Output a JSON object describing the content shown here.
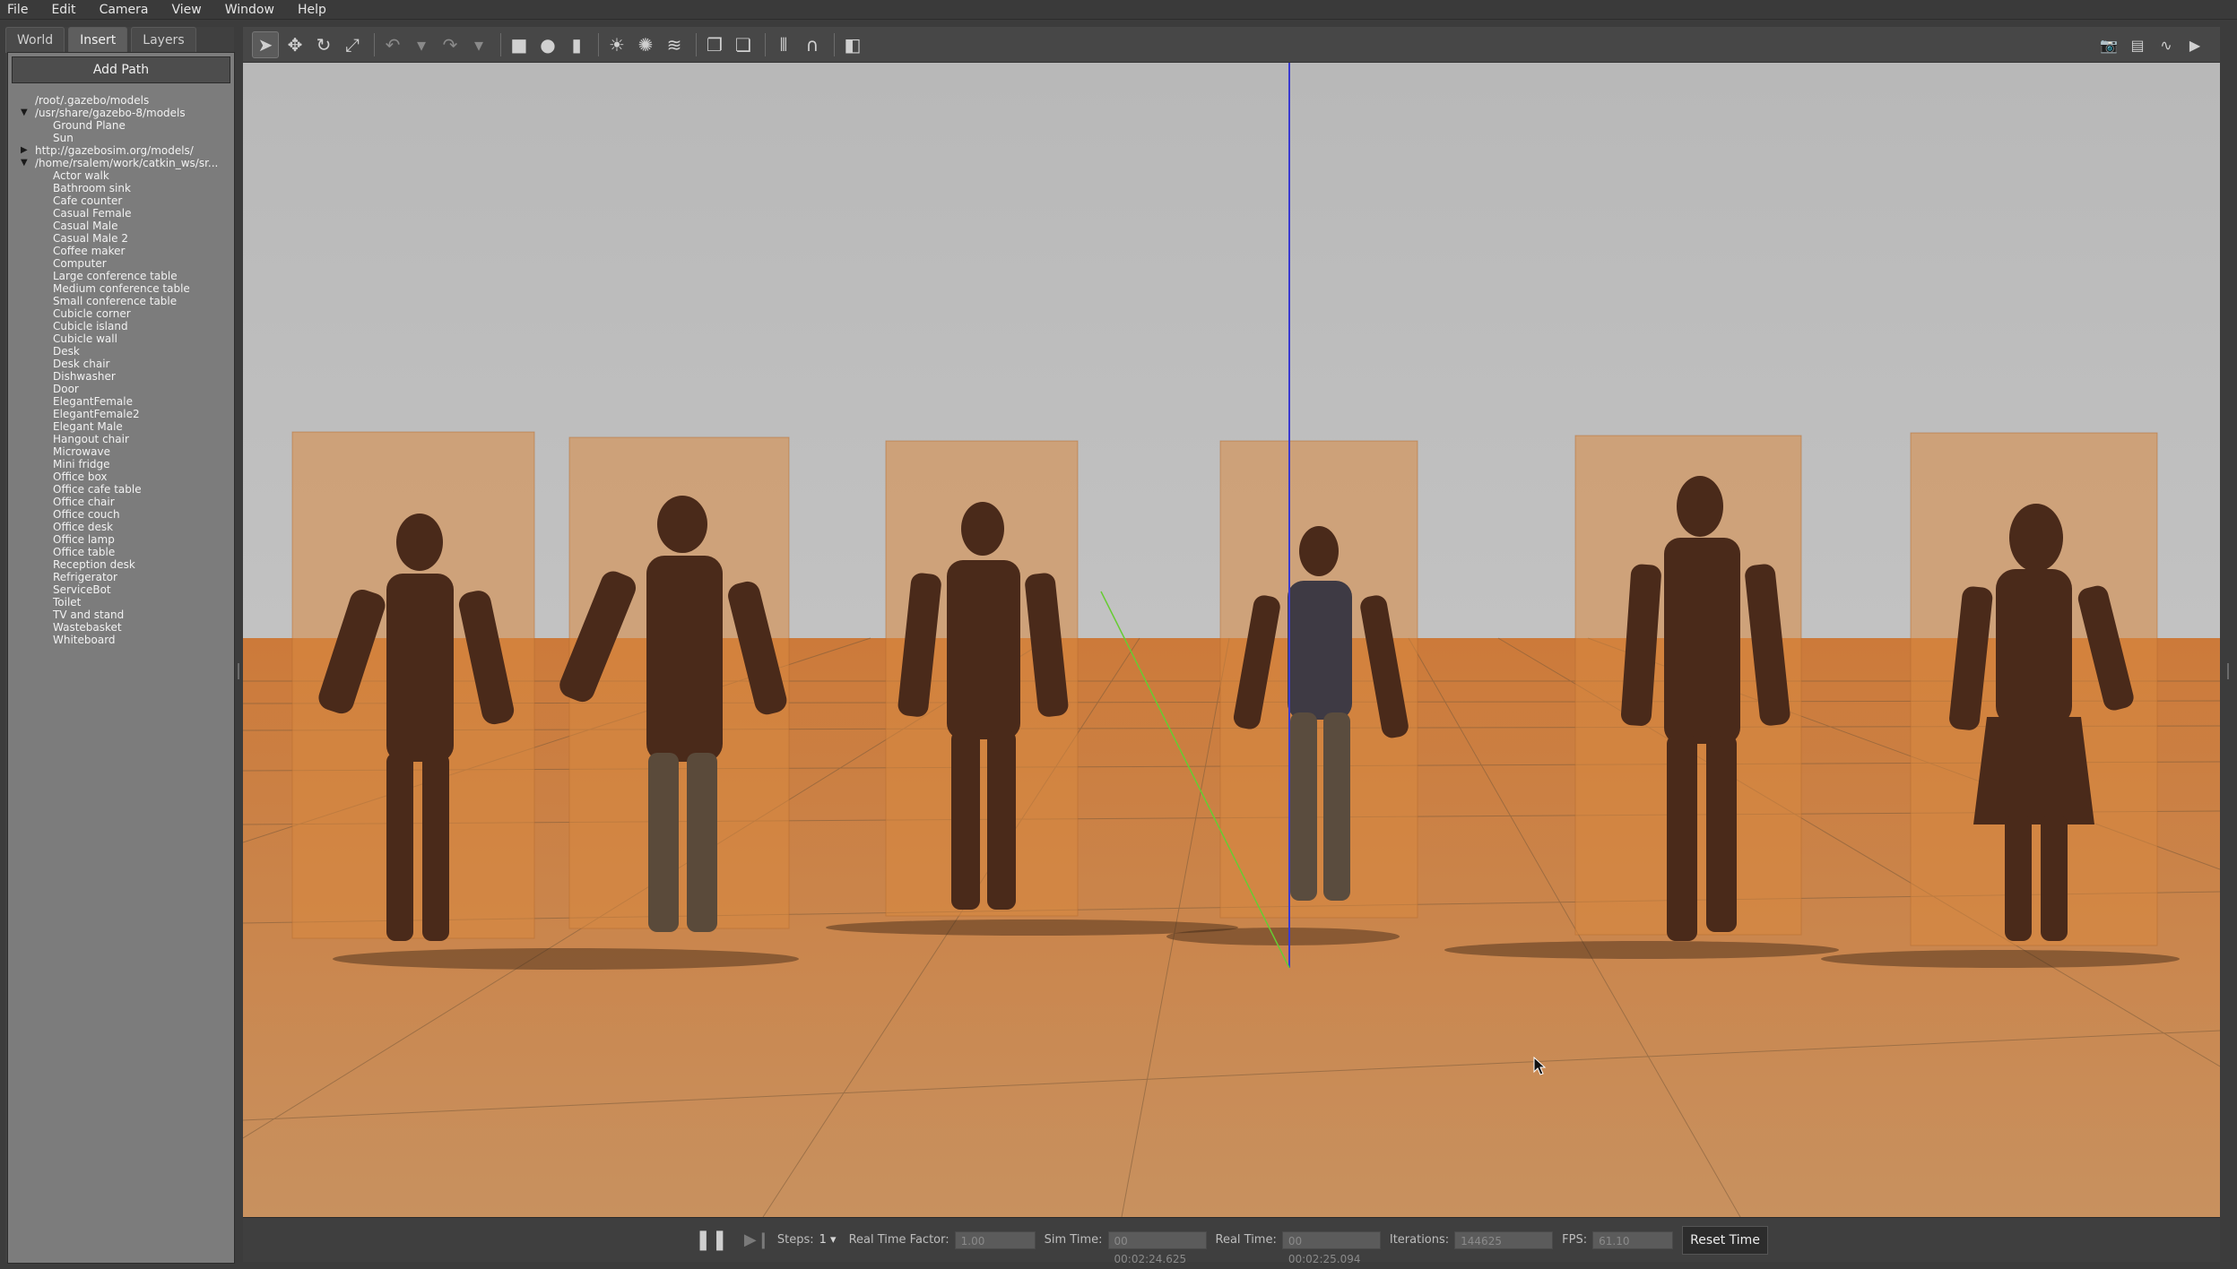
{
  "menu": [
    {
      "label": "File",
      "u": "F"
    },
    {
      "label": "Edit",
      "u": "E"
    },
    {
      "label": "Camera",
      "u": "C"
    },
    {
      "label": "View",
      "u": "V"
    },
    {
      "label": "Window",
      "u": "W"
    },
    {
      "label": "Help",
      "u": "H"
    }
  ],
  "tabs": [
    {
      "label": "World",
      "active": false
    },
    {
      "label": "Insert",
      "active": true
    },
    {
      "label": "Layers",
      "active": false
    }
  ],
  "add_path_label": "Add Path",
  "tree": {
    "roots": [
      {
        "label": "/root/.gazebo/models",
        "expanded": null
      },
      {
        "label": "/usr/share/gazebo-8/models",
        "expanded": true
      },
      {
        "label": "Ground Plane",
        "child": true
      },
      {
        "label": "Sun",
        "child": true
      },
      {
        "label": "http://gazebosim.org/models/",
        "expanded": false
      },
      {
        "label": "/home/rsalem/work/catkin_ws/sr...",
        "expanded": true
      }
    ],
    "models": [
      "Actor walk",
      "Bathroom sink",
      "Cafe counter",
      "Casual Female",
      "Casual Male",
      "Casual Male 2",
      "Coffee maker",
      "Computer",
      "Large conference table",
      "Medium conference table",
      "Small conference table",
      "Cubicle corner",
      "Cubicle island",
      "Cubicle wall",
      "Desk",
      "Desk chair",
      "Dishwasher",
      "Door",
      "ElegantFemale",
      "ElegantFemale2",
      "Elegant Male",
      "Hangout chair",
      "Microwave",
      "Mini fridge",
      "Office box",
      "Office cafe table",
      "Office chair",
      "Office couch",
      "Office desk",
      "Office lamp",
      "Office table",
      "Reception desk",
      "Refrigerator",
      "ServiceBot",
      "Toilet",
      "TV and stand",
      "Wastebasket",
      "Whiteboard"
    ]
  },
  "toolbar": {
    "left": [
      {
        "name": "select-mode-icon",
        "glyph": "➤",
        "active": true
      },
      {
        "name": "translate-mode-icon",
        "glyph": "✥"
      },
      {
        "name": "rotate-mode-icon",
        "glyph": "↻"
      },
      {
        "name": "scale-mode-icon",
        "glyph": "⤢"
      },
      {
        "sep": true
      },
      {
        "name": "undo-icon",
        "glyph": "↶",
        "dim": true
      },
      {
        "name": "undo-history-icon",
        "glyph": "▾",
        "dim": true
      },
      {
        "name": "redo-icon",
        "glyph": "↷",
        "dim": true
      },
      {
        "name": "redo-history-icon",
        "glyph": "▾",
        "dim": true
      },
      {
        "sep": true
      },
      {
        "name": "box-shape-icon",
        "glyph": "■"
      },
      {
        "name": "sphere-shape-icon",
        "glyph": "●"
      },
      {
        "name": "cylinder-shape-icon",
        "glyph": "▮"
      },
      {
        "sep": true
      },
      {
        "name": "point-light-icon",
        "glyph": "☀"
      },
      {
        "name": "spot-light-icon",
        "glyph": "✺"
      },
      {
        "name": "directional-light-icon",
        "glyph": "≋"
      },
      {
        "sep": true
      },
      {
        "name": "copy-icon",
        "glyph": "❐"
      },
      {
        "name": "paste-icon",
        "glyph": "❏"
      },
      {
        "sep": true
      },
      {
        "name": "align-icon",
        "glyph": "⫴"
      },
      {
        "name": "snap-icon",
        "glyph": "∩"
      },
      {
        "sep": true
      },
      {
        "name": "view-angle-icon",
        "glyph": "◧"
      }
    ],
    "right": [
      {
        "name": "screenshot-icon",
        "glyph": "📷"
      },
      {
        "name": "log-icon",
        "glyph": "▤"
      },
      {
        "name": "plot-icon",
        "glyph": "∿"
      },
      {
        "name": "video-record-icon",
        "glyph": "▶"
      }
    ]
  },
  "status": {
    "steps_label": "Steps:",
    "steps_value": "1",
    "rtf_label": "Real Time Factor:",
    "rtf_value": "1.00",
    "sim_time_label": "Sim Time:",
    "sim_time_value": "00 00:02:24.625",
    "real_time_label": "Real Time:",
    "real_time_value": "00 00:02:25.094",
    "iterations_label": "Iterations:",
    "iterations_value": "144625",
    "fps_label": "FPS:",
    "fps_value": "61.10",
    "reset_label": "Reset Time"
  },
  "colors": {
    "sky": "#b3b3b3",
    "ground": "#c08f5c",
    "box": "#d78a45",
    "axis_z": "#3a3ad0",
    "axis_y": "#66cc33"
  },
  "scene": {
    "actor_count": 6
  }
}
